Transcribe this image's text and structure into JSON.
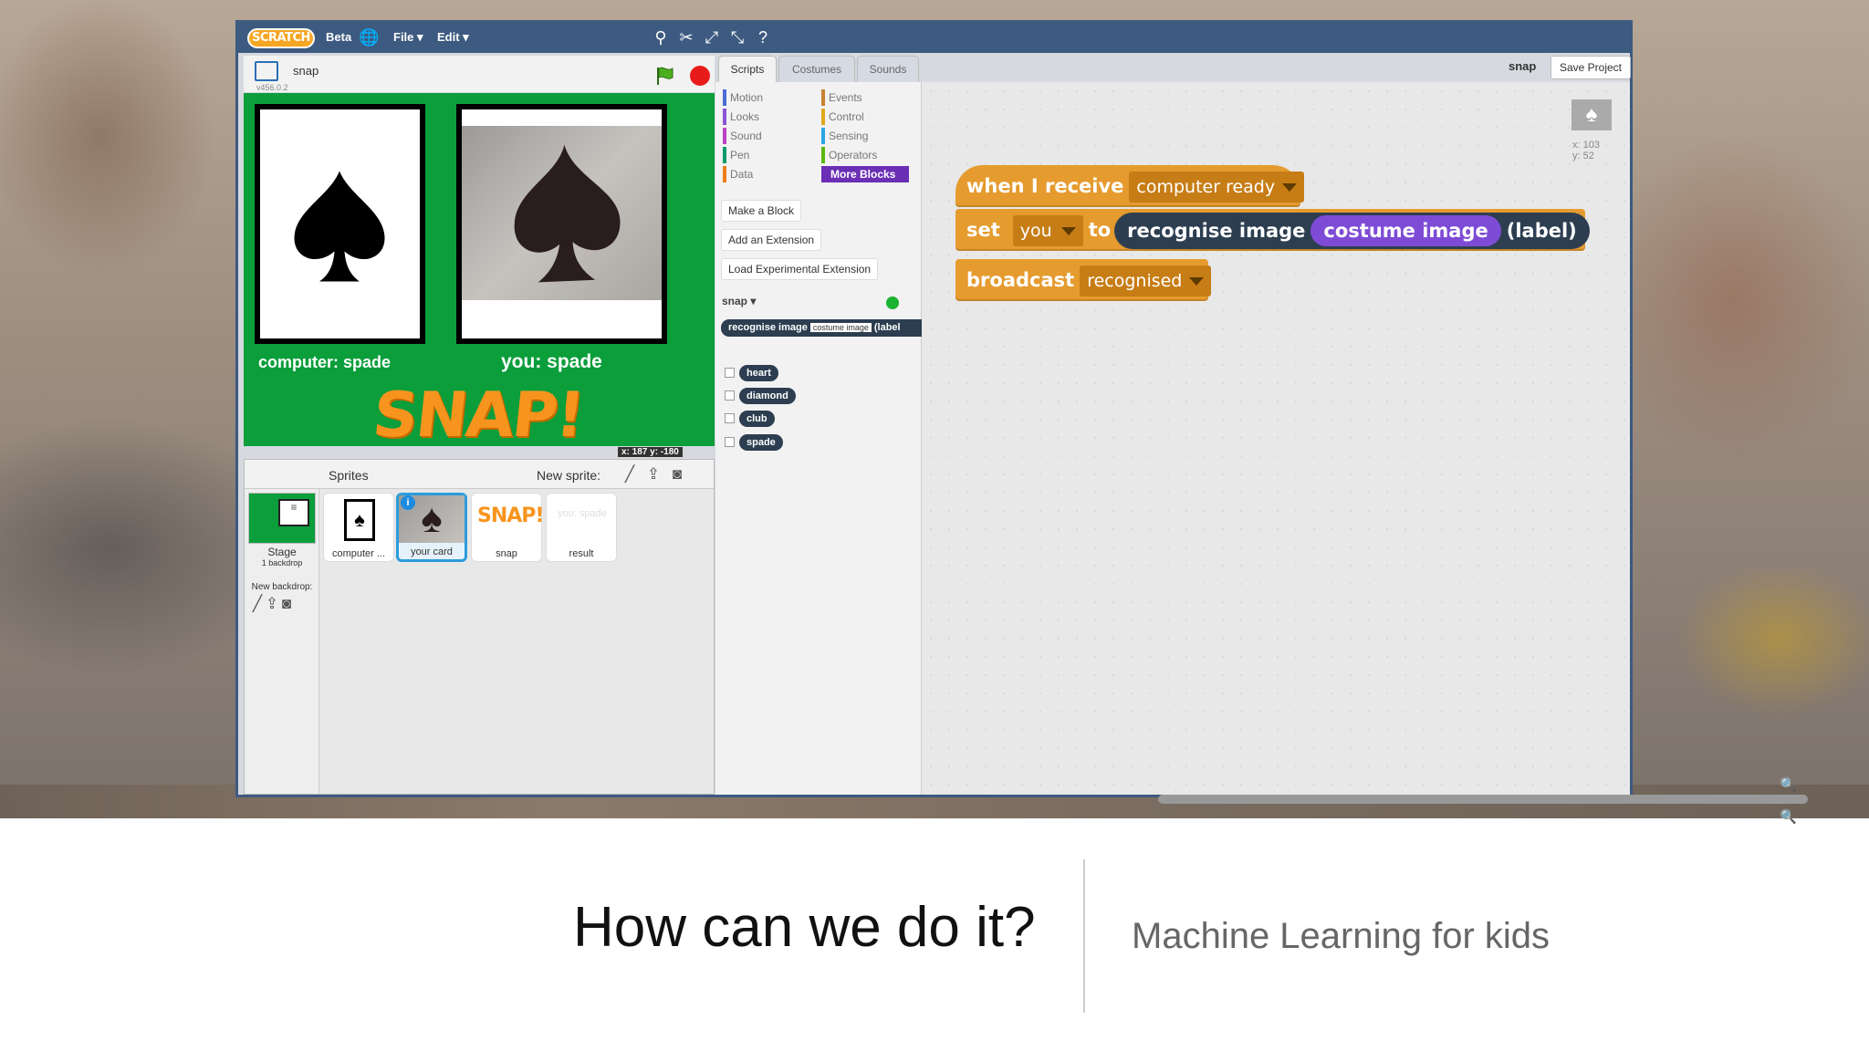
{
  "menubar": {
    "logo_text": "SCRATCH",
    "beta_label": "Beta",
    "file_menu": "File ▾",
    "edit_menu": "Edit ▾"
  },
  "stage": {
    "project_title": "snap",
    "version": "v456.0.2",
    "computer_label": "computer:  spade",
    "you_label": "you: spade",
    "snap_logo": "SNAP!",
    "coords": "x: 187   y: -180"
  },
  "sprites_panel": {
    "title": "Sprites",
    "new_sprite_label": "New sprite:",
    "stage_label": "Stage",
    "stage_backdrops": "1 backdrop",
    "new_backdrop_label": "New backdrop:",
    "sprites": [
      {
        "name": "computer ..."
      },
      {
        "name": "your card",
        "selected": true
      },
      {
        "name": "snap"
      },
      {
        "name": "result",
        "thumb_text": "you: spade"
      }
    ]
  },
  "tabs": [
    "Scripts",
    "Costumes",
    "Sounds"
  ],
  "palette": {
    "categories": [
      {
        "label": "Motion",
        "color": "#4a6cd4"
      },
      {
        "label": "Looks",
        "color": "#8a55d7"
      },
      {
        "label": "Sound",
        "color": "#bb42c3"
      },
      {
        "label": "Pen",
        "color": "#0e9a6c"
      },
      {
        "label": "Data",
        "color": "#ee7d16"
      },
      {
        "label": "Events",
        "color": "#c88330"
      },
      {
        "label": "Control",
        "color": "#e1a91a"
      },
      {
        "label": "Sensing",
        "color": "#2ca5e2"
      },
      {
        "label": "Operators",
        "color": "#5cb712"
      },
      {
        "label": "More Blocks",
        "color": "#632d99"
      }
    ],
    "buttons": [
      "Make a Block",
      "Add an Extension",
      "Load Experimental Extension"
    ],
    "extension_name": "snap ▾",
    "recognise_block": {
      "part1": "recognise  image",
      "slot": "costume image",
      "part2": "(label"
    },
    "labels": [
      "heart",
      "diamond",
      "club",
      "spade"
    ]
  },
  "script_area": {
    "sprite_name": "snap",
    "save_button": "Save Project",
    "sprite_x": "x: 103",
    "sprite_y": "y: 52",
    "blocks": {
      "when_receive_text": "when  I  receive",
      "when_receive_value": "computer ready",
      "set_text": "set",
      "set_var": "you",
      "to_text": "to",
      "recognise_text": "recognise  image",
      "costume_text": "costume  image",
      "label_text": "(label)",
      "broadcast_text": "broadcast",
      "broadcast_value": "recognised"
    },
    "zoom_controls": "🔍 = 🔍"
  },
  "slide": {
    "title": "How can we do it?",
    "subtitle": "Machine Learning for kids"
  }
}
